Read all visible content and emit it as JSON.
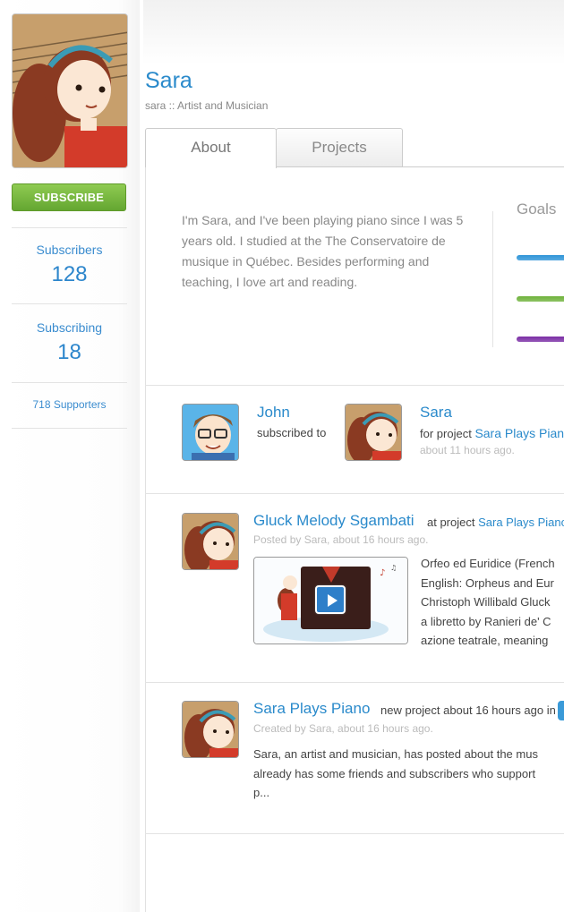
{
  "profile": {
    "name": "Sara",
    "subtitle": "sara :: Artist and Musician",
    "subscribe_label": "SUBSCRIBE"
  },
  "stats": {
    "subscribers_label": "Subscribers",
    "subscribers_count": "128",
    "subscribing_label": "Subscribing",
    "subscribing_count": "18",
    "supporters": "718 Supporters"
  },
  "tabs": [
    {
      "label": "About",
      "active": true
    },
    {
      "label": "Projects",
      "active": false
    }
  ],
  "about": {
    "text": "I'm Sara, and I've been playing piano since I was 5 years old. I studied at the The Conservatoire de musique in Québec. Besides performing and teaching, I love art and reading.",
    "goals_label": "Goals",
    "goal_colors": [
      "#2f95d8",
      "#6fb33c",
      "#7b2fa6"
    ]
  },
  "feed": [
    {
      "actor": "John",
      "action": "subscribed to",
      "target": "Sara",
      "for_project_prefix": "for project",
      "project": "Sara Plays Piano",
      "time": "about 11 hours ago."
    },
    {
      "title": "Gluck Melody Sgambati",
      "at_project_prefix": "at project",
      "project": "Sara Plays Piano",
      "meta": "Posted by Sara, about 16 hours ago.",
      "description_lines": [
        "Orfeo ed Euridice (French",
        "English: Orpheus and Eur",
        "Christoph Willibald Gluck",
        "a libretto by Ranieri de' C",
        "azione teatrale, meaning"
      ]
    },
    {
      "title": "Sara Plays Piano",
      "action": "new project about 16 hours ago in",
      "meta": "Created by Sara, about 16 hours ago.",
      "description_lines": [
        "Sara, an artist and musician, has posted about the mus",
        "already has some friends and subscribers who support",
        "p..."
      ]
    }
  ]
}
